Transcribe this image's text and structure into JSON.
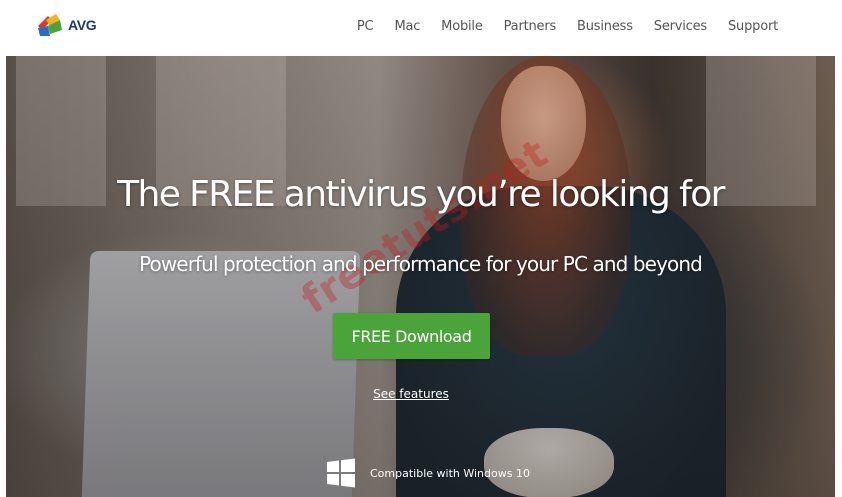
{
  "header": {
    "logo_text": "AVG",
    "nav": [
      "PC",
      "Mac",
      "Mobile",
      "Partners",
      "Business",
      "Services",
      "Support"
    ]
  },
  "hero": {
    "headline": "The FREE antivirus you’re looking for",
    "subheadline": "Powerful protection and performance for your PC and beyond",
    "cta_label": "FREE Download",
    "features_link": "See features",
    "compat_text": "Compatible with Windows 10",
    "compat_icon": "windows-logo-icon"
  },
  "watermark": {
    "text": "freetuts.net"
  },
  "colors": {
    "cta_green": "#4aa43a",
    "logo_blue": "#1a3d6e",
    "watermark_red": "#c81919"
  }
}
